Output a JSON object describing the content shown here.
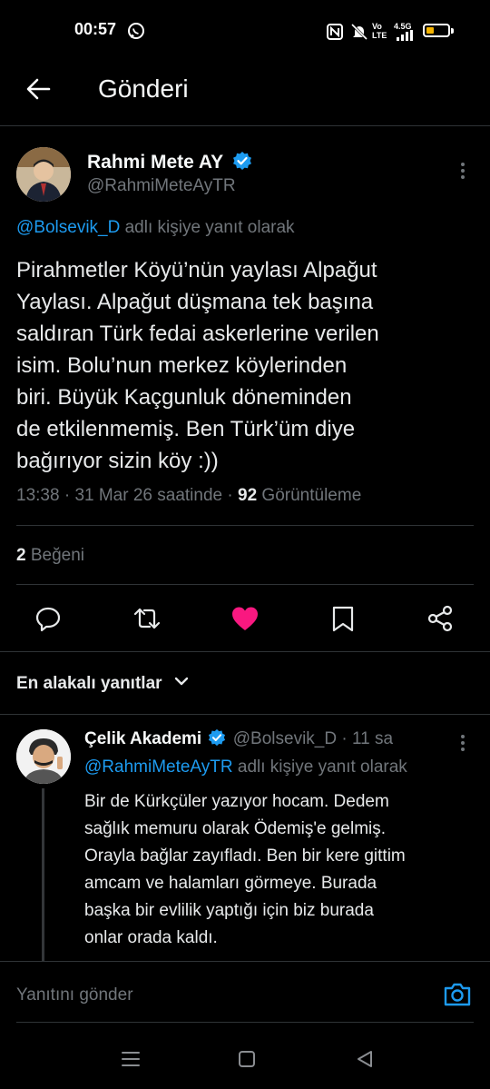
{
  "status_bar": {
    "time": "00:57",
    "icons": [
      "whatsapp-icon",
      "nfc-icon",
      "mute-icon",
      "volte-icon",
      "signal-icon",
      "battery-icon"
    ],
    "network_label": "4.5G",
    "volte_label": "Vo LTE",
    "battery_color": "#f5b400",
    "battery_level": 0.35
  },
  "header": {
    "title": "Gönderi"
  },
  "tweet": {
    "author_name": "Rahmi Mete AY",
    "author_handle": "@RahmiMeteAyTR",
    "reply_to_mention": "@Bolsevik_D",
    "reply_to_suffix": " adlı kişiye yanıt olarak",
    "text_lines": [
      "Pirahmetler Köyü’nün yaylası Alpağut",
      "Yaylası. Alpağut düşmana tek başına",
      "saldıran Türk fedai askerlerine verilen",
      "isim. Bolu’nun merkez köylerinden",
      "biri. Büyük Kaçgunluk döneminden",
      "de etkilenmemiş. Ben Türk’üm diye",
      "bağırıyor sizin köy :))"
    ],
    "time": "13:38",
    "date": "31 Mar 26 saatinde",
    "views_count": "92",
    "views_label": "Görüntüleme",
    "likes_count": "2",
    "likes_label": "Beğeni",
    "liked": true,
    "like_color": "#f91880"
  },
  "sort": {
    "label": "En alakalı yanıtlar"
  },
  "reply": {
    "author_name": "Çelik Akademi",
    "author_handle": "@Bolsevik_D",
    "age": "11 sa",
    "reply_to_mention": "@RahmiMeteAyTR",
    "reply_to_suffix": " adlı kişiye yanıt olarak",
    "text_lines": [
      "Bir de Kürkçüler yazıyor hocam. Dedem",
      "sağlık memuru olarak Ödemiş'e gelmiş.",
      "Orayla bağlar zayıfladı. Ben bir kere gittim",
      "amcam ve halamları görmeye. Burada",
      "başka bir evlilik yaptığı için biz burada",
      "onlar orada kaldı."
    ]
  },
  "compose": {
    "placeholder": "Yanıtını gönder"
  },
  "colors": {
    "accent": "#1d9bf0",
    "muted": "#71767b",
    "divider": "#2f3336"
  }
}
